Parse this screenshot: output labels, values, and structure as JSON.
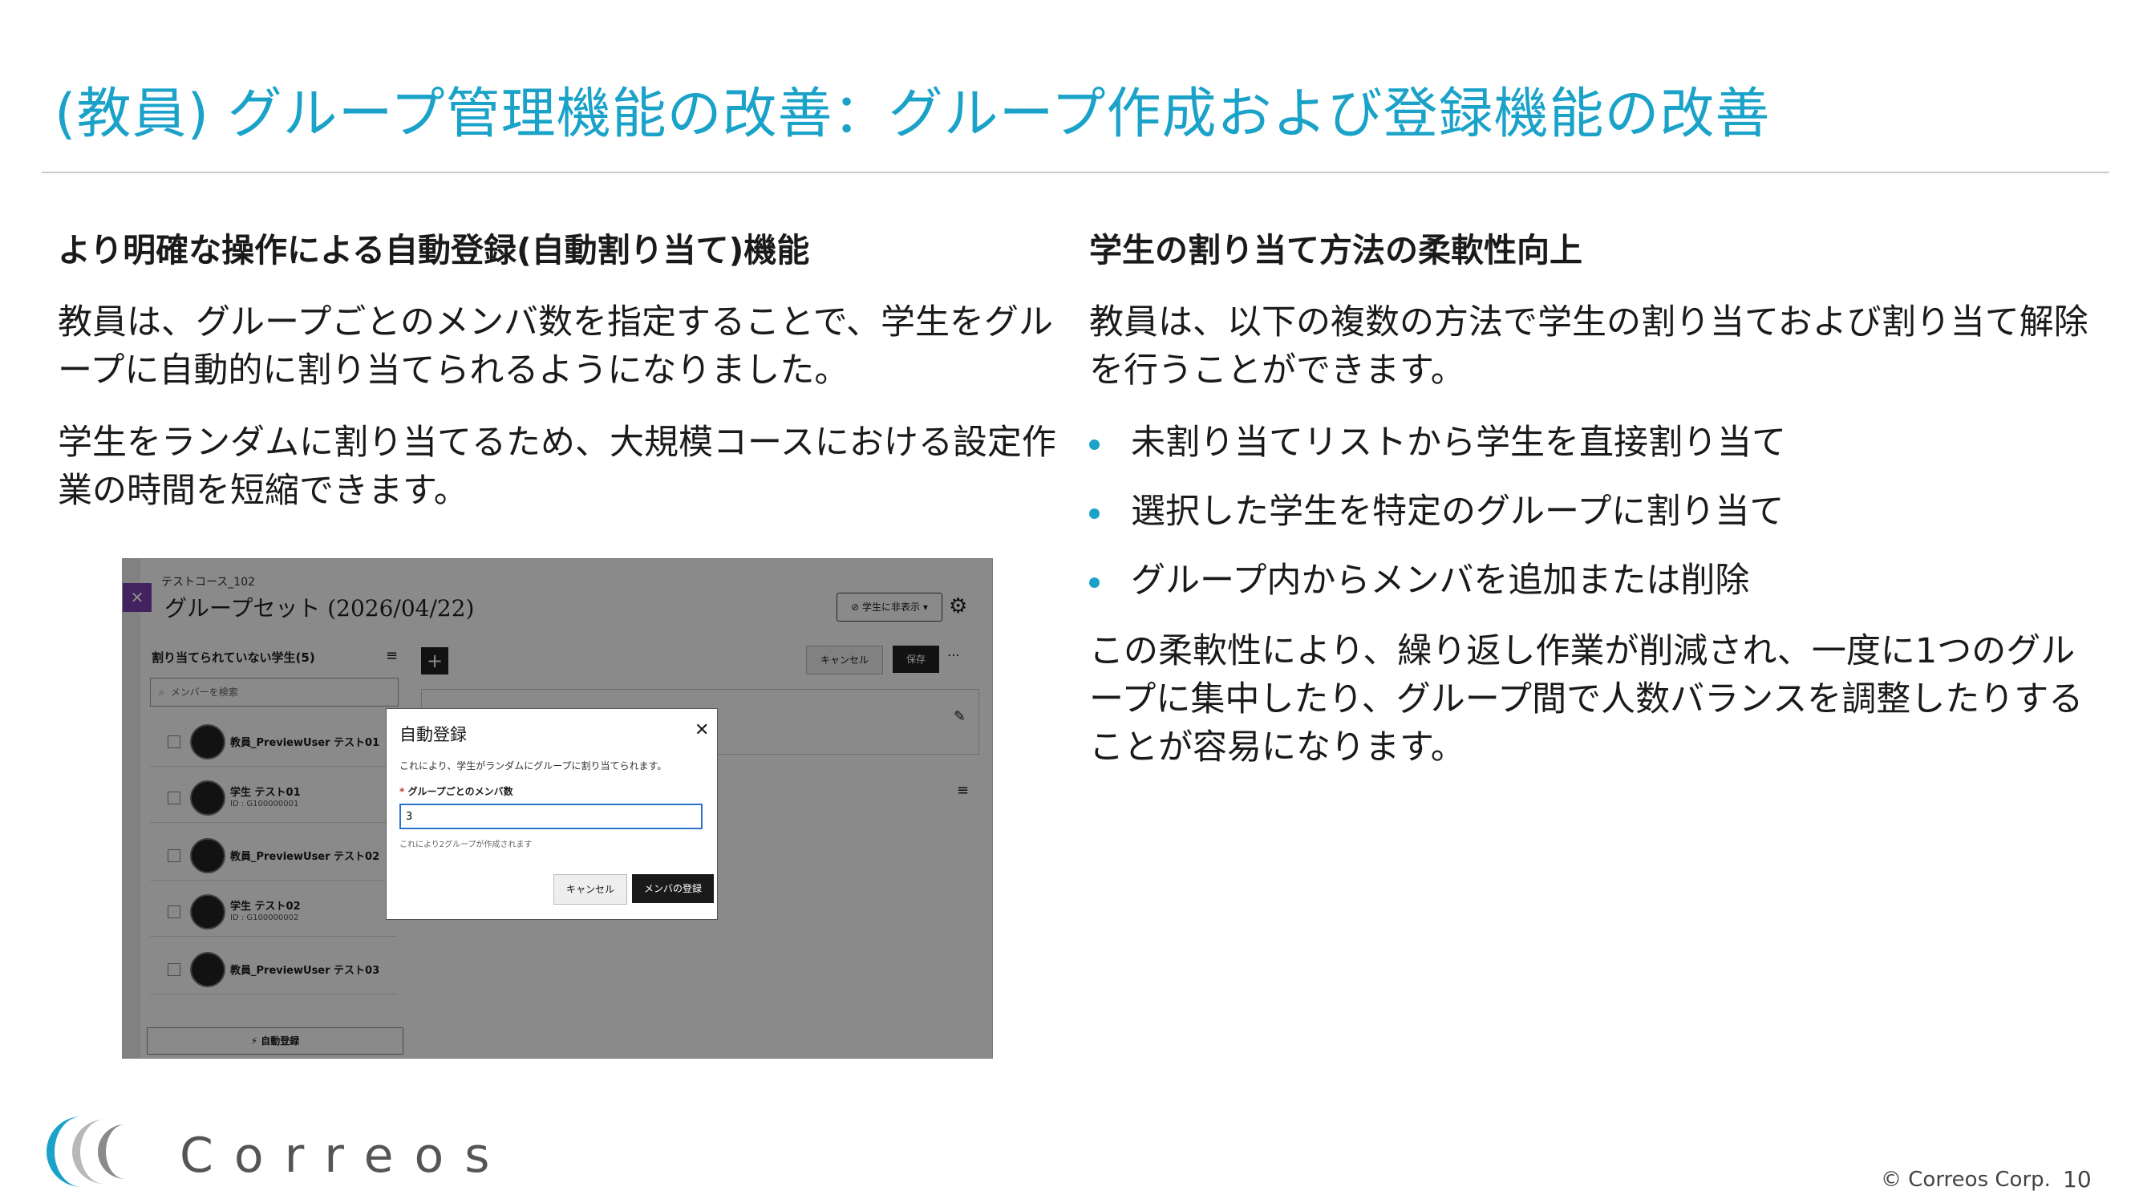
{
  "title": "(教員) グループ管理機能の改善：グループ作成および登録機能の改善",
  "left": {
    "heading": "より明確な操作による自動登録(自動割り当て)機能",
    "para1": "教員は、グループごとのメンバ数を指定することで、学生をグループに自動的に割り当てられるようになりました。",
    "para2": "学生をランダムに割り当てるため、大規模コースにおける設定作業の時間を短縮できます。"
  },
  "right": {
    "heading": "学生の割り当て方法の柔軟性向上",
    "para1": "教員は、以下の複数の方法で学生の割り当ておよび割り当て解除を行うことができます。",
    "bullets": [
      "未割り当てリストから学生を直接割り当て",
      "選択した学生を特定のグループに割り当て",
      "グループ内からメンバを追加または削除"
    ],
    "para2": "この柔軟性により、繰り返し作業が削減され、一度に1つのグループに集中したり、グループ間で人数バランスを調整したりすることが容易になります。"
  },
  "screenshot": {
    "course": "テストコース_102",
    "group_set_title": "グループセット (2026/04/22)",
    "show_toggle": "学生に非表示 ▾",
    "unassigned_title": "割り当てられていない学生(5)",
    "search_placeholder": "メンバーを検索",
    "members": [
      {
        "name": "教員_PreviewUser テスト01",
        "id": ""
      },
      {
        "name": "学生 テスト01",
        "id": "ID : G100000001"
      },
      {
        "name": "教員_PreviewUser テスト02",
        "id": ""
      },
      {
        "name": "学生 テスト02",
        "id": "ID : G100000002"
      },
      {
        "name": "教員_PreviewUser テスト03",
        "id": ""
      }
    ],
    "auto_enroll_button": "自動登録",
    "cancel": "キャンセル",
    "save": "保存",
    "modal": {
      "title": "自動登録",
      "description": "これにより、学生がランダムにグループに割り当てられます。",
      "field_label": "グループごとのメンバ数",
      "required_mark": "*",
      "field_value": "3",
      "hint": "これにより2グループが作成されます",
      "cancel": "キャンセル",
      "register": "メンバの登録"
    }
  },
  "footer": {
    "brand": "Correos",
    "copyright": "© Correos Corp.",
    "page": "10"
  },
  "colors": {
    "accent": "#1aa2c8",
    "logo_gray": "#9a9a9a"
  }
}
